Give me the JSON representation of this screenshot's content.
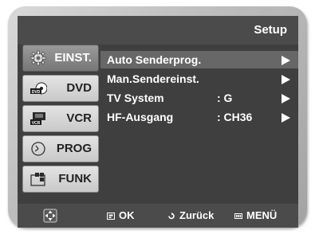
{
  "header": {
    "title": "Setup"
  },
  "sidebar": {
    "items": [
      {
        "label": "EINST.",
        "icon": "gear-icon",
        "active": true
      },
      {
        "label": "DVD",
        "icon": "dvd-disc-icon",
        "badge": "DVD"
      },
      {
        "label": "VCR",
        "icon": "vcr-tape-icon",
        "badge": "VCR"
      },
      {
        "label": "PROG",
        "icon": "timer-clock-icon"
      },
      {
        "label": "FUNK",
        "icon": "function-grid-icon"
      }
    ]
  },
  "menu": {
    "items": [
      {
        "label": "Auto Senderprog.",
        "value": "",
        "selected": true
      },
      {
        "label": "Man.Sendereinst.",
        "value": ""
      },
      {
        "label": "TV System",
        "value": ": G"
      },
      {
        "label": "HF-Ausgang",
        "value": ": CH36"
      }
    ]
  },
  "footer": {
    "nav_icon": "dpad-icon",
    "ok_label": "OK",
    "back_label": "Zurück",
    "menu_label": "MENÜ"
  },
  "colors": {
    "screen_bg": "#3f3f3f",
    "bar_bg": "#4b4b4b",
    "selected_row": "#676767",
    "text": "#ffffff"
  }
}
